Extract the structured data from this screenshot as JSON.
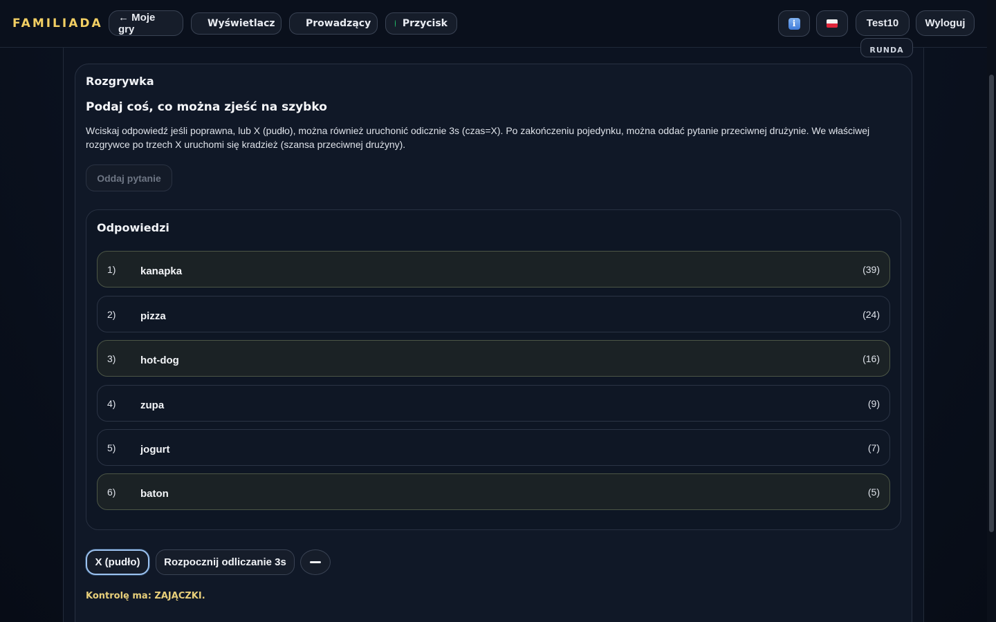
{
  "header": {
    "brand": "FAMILIADA",
    "back_label": "← Moje gry",
    "tabs": [
      {
        "label": "Wyświetlacz",
        "status_color": "#22c16a"
      },
      {
        "label": "Prowadzący",
        "status_color": "#22c16a"
      },
      {
        "label": "Przycisk",
        "status_color": "#22c16a"
      }
    ],
    "info_icon": "info-icon",
    "flag_icon": "poland-flag-icon",
    "user_label": "Test10",
    "logout_label": "Wyloguj"
  },
  "round_tag": "RUNDA",
  "game": {
    "title": "Rozgrywka",
    "question": "Podaj coś, co można zjeść na szybko",
    "description": "Wciskaj odpowiedź jeśli poprawna, lub X (pudło), można również uruchonić odicznie 3s (czas=X). Po zakończeniu pojedynku, można oddać pytanie przeciwnej drużynie. We właściwej rozgrywce po trzech X uruchomi się kradzież (szansa przeciwnej drużyny).",
    "give_question_label": "Oddaj pytanie",
    "answers_title": "Odpowiedzi",
    "answers": [
      {
        "num": "1)",
        "text": "kanapka",
        "points": "(39)",
        "revealed": true
      },
      {
        "num": "2)",
        "text": "pizza",
        "points": "(24)",
        "revealed": false
      },
      {
        "num": "3)",
        "text": "hot-dog",
        "points": "(16)",
        "revealed": true
      },
      {
        "num": "4)",
        "text": "zupa",
        "points": "(9)",
        "revealed": false
      },
      {
        "num": "5)",
        "text": "jogurt",
        "points": "(7)",
        "revealed": false
      },
      {
        "num": "6)",
        "text": "baton",
        "points": "(5)",
        "revealed": true
      }
    ],
    "miss_label": "X (pudło)",
    "countdown_label": "Rozpocznij odliczanie 3s",
    "control_text": "Kontrolę ma: ZAJĄCZKI."
  }
}
